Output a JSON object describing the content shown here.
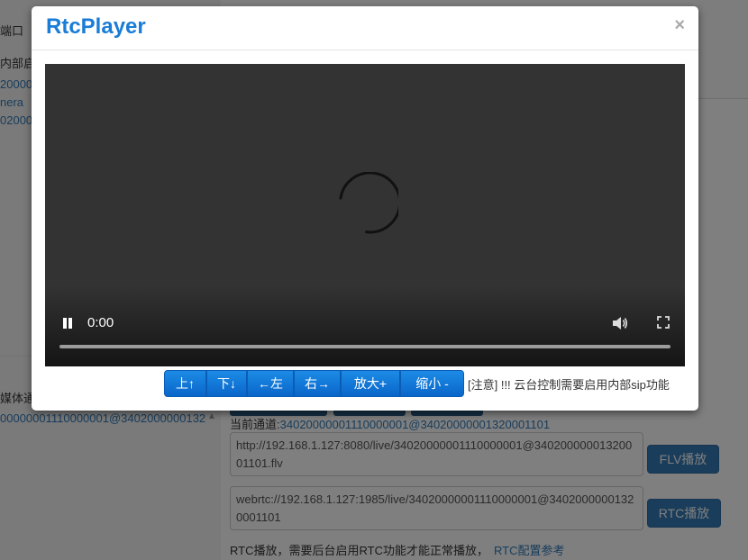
{
  "background": {
    "left_fragments": [
      "端口",
      "内部启",
      "20000",
      "nera",
      "02000"
    ],
    "media_channel_label": "媒体通道",
    "channel_list_item": "00000001110000001@3402000000132",
    "current_channel_label": "当前通道:",
    "current_channel_value": "34020000001110000001@34020000001320001101",
    "flv_url": "http://192.168.1.127:8080/live/34020000001110000001@34020000001320001101.flv",
    "flv_button": "FLV播放",
    "rtc_url": "webrtc://192.168.1.127:1985/live/34020000001110000001@34020000001320001101",
    "rtc_button": "RTC播放",
    "rtc_note": "RTC播放，需要后台启用RTC功能才能正常播放，",
    "rtc_link": "RTC配置参考"
  },
  "modal": {
    "title": "RtcPlayer",
    "close": "×",
    "video": {
      "time": "0:00",
      "progress": 0
    },
    "ptz_buttons": [
      {
        "label": "上↑",
        "width": 47
      },
      {
        "label": "下↓",
        "width": 45
      },
      {
        "label": "←左",
        "width": 52
      },
      {
        "label": "右→",
        "width": 52
      },
      {
        "label": "放大+",
        "width": 66
      },
      {
        "label": "缩小 -",
        "width": 71
      }
    ],
    "note": "[注意] !!! 云台控制需要启用内部sip功能"
  }
}
